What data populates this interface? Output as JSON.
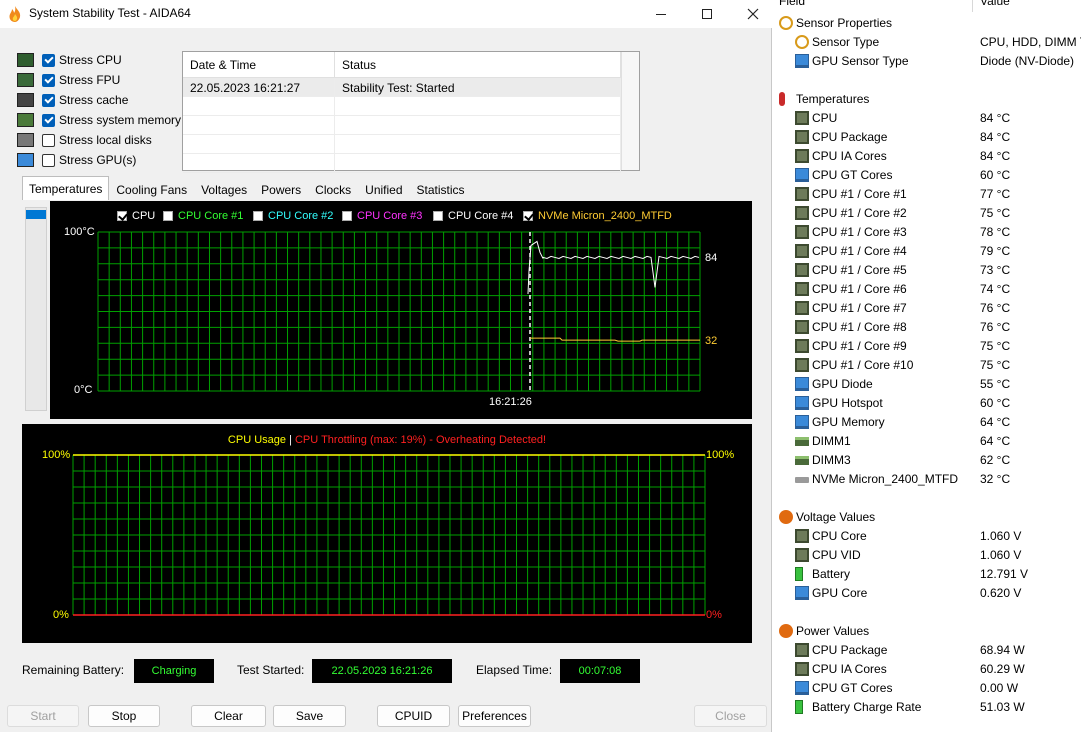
{
  "window": {
    "title": "System Stability Test - AIDA64",
    "buttons": {
      "minimize": "—",
      "maximize": "□",
      "close": "✕"
    }
  },
  "stress_options": [
    {
      "label": "Stress CPU",
      "checked": true,
      "icon": "cpu-icon"
    },
    {
      "label": "Stress FPU",
      "checked": true,
      "icon": "fpu-icon"
    },
    {
      "label": "Stress cache",
      "checked": true,
      "icon": "cache-icon"
    },
    {
      "label": "Stress system memory",
      "checked": true,
      "icon": "memory-icon"
    },
    {
      "label": "Stress local disks",
      "checked": false,
      "icon": "disk-icon"
    },
    {
      "label": "Stress GPU(s)",
      "checked": false,
      "icon": "gpu-icon"
    }
  ],
  "log": {
    "headers": [
      "Date & Time",
      "Status"
    ],
    "rows": [
      {
        "datetime": "22.05.2023 16:21:27",
        "status": "Stability Test: Started"
      }
    ]
  },
  "tabs": [
    "Temperatures",
    "Cooling Fans",
    "Voltages",
    "Powers",
    "Clocks",
    "Unified",
    "Statistics"
  ],
  "temp_graph": {
    "legend": [
      {
        "label": "CPU",
        "checked": true,
        "color": "#ffffff"
      },
      {
        "label": "CPU Core #1",
        "checked": false,
        "color": "#33ff33"
      },
      {
        "label": "CPU Core #2",
        "checked": false,
        "color": "#33ffff"
      },
      {
        "label": "CPU Core #3",
        "checked": false,
        "color": "#ff33ff"
      },
      {
        "label": "CPU Core #4",
        "checked": false,
        "color": "#ffffff"
      },
      {
        "label": "NVMe Micron_2400_MTFD",
        "checked": true,
        "color": "#ffcc33"
      }
    ],
    "y_max_label": "100°C",
    "y_min_label": "0°C",
    "time_label": "16:21:26",
    "cpu_value_label": "84",
    "nvme_value_label": "32",
    "cpu_value": 84,
    "nvme_value": 32,
    "grid_color": "#00a000"
  },
  "usage_graph": {
    "title_usage": "CPU Usage",
    "title_sep": "|",
    "title_throttle": "CPU Throttling (max: 19%) - Overheating Detected!",
    "left_max": "100%",
    "left_min": "0%",
    "right_max": "100%",
    "right_min": "0%",
    "usage_color": "#ffff00",
    "throttle_color": "#ff2020"
  },
  "status_bar": {
    "battery_label": "Remaining Battery:",
    "battery_value": "Charging",
    "started_label": "Test Started:",
    "started_value": "22.05.2023 16:21:26",
    "elapsed_label": "Elapsed Time:",
    "elapsed_value": "00:07:08"
  },
  "buttons": {
    "start": "Start",
    "stop": "Stop",
    "clear": "Clear",
    "save": "Save",
    "cpuid": "CPUID",
    "preferences": "Preferences",
    "close": "Close"
  },
  "sensor_panel": {
    "col_field": "Field",
    "col_value": "Value",
    "groups": [
      {
        "title": "Sensor Properties",
        "icon": "sensor-icon",
        "items": [
          {
            "name": "Sensor Type",
            "value": "CPU, HDD, DIMM T",
            "icon": "gauge-icon"
          },
          {
            "name": "GPU Sensor Type",
            "value": "Diode  (NV-Diode)",
            "icon": "monitor-icon"
          }
        ]
      },
      {
        "title": "Temperatures",
        "icon": "thermometer-icon",
        "items": [
          {
            "name": "CPU",
            "value": "84 °C",
            "icon": "chip-icon"
          },
          {
            "name": "CPU Package",
            "value": "84 °C",
            "icon": "chip-icon"
          },
          {
            "name": "CPU IA Cores",
            "value": "84 °C",
            "icon": "chip-icon"
          },
          {
            "name": "CPU GT Cores",
            "value": "60 °C",
            "icon": "monitor-icon"
          },
          {
            "name": "CPU #1 / Core #1",
            "value": "77 °C",
            "icon": "chip-icon"
          },
          {
            "name": "CPU #1 / Core #2",
            "value": "75 °C",
            "icon": "chip-icon"
          },
          {
            "name": "CPU #1 / Core #3",
            "value": "78 °C",
            "icon": "chip-icon"
          },
          {
            "name": "CPU #1 / Core #4",
            "value": "79 °C",
            "icon": "chip-icon"
          },
          {
            "name": "CPU #1 / Core #5",
            "value": "73 °C",
            "icon": "chip-icon"
          },
          {
            "name": "CPU #1 / Core #6",
            "value": "74 °C",
            "icon": "chip-icon"
          },
          {
            "name": "CPU #1 / Core #7",
            "value": "76 °C",
            "icon": "chip-icon"
          },
          {
            "name": "CPU #1 / Core #8",
            "value": "76 °C",
            "icon": "chip-icon"
          },
          {
            "name": "CPU #1 / Core #9",
            "value": "75 °C",
            "icon": "chip-icon"
          },
          {
            "name": "CPU #1 / Core #10",
            "value": "75 °C",
            "icon": "chip-icon"
          },
          {
            "name": "GPU Diode",
            "value": "55 °C",
            "icon": "monitor-icon"
          },
          {
            "name": "GPU Hotspot",
            "value": "60 °C",
            "icon": "monitor-icon"
          },
          {
            "name": "GPU Memory",
            "value": "64 °C",
            "icon": "monitor-icon"
          },
          {
            "name": "DIMM1",
            "value": "64 °C",
            "icon": "dimm-icon"
          },
          {
            "name": "DIMM3",
            "value": "62 °C",
            "icon": "dimm-icon"
          },
          {
            "name": "NVMe Micron_2400_MTFD",
            "value": "32 °C",
            "icon": "nvme-icon"
          }
        ]
      },
      {
        "title": "Voltage Values",
        "icon": "voltage-icon",
        "items": [
          {
            "name": "CPU Core",
            "value": "1.060 V",
            "icon": "chip-icon"
          },
          {
            "name": "CPU VID",
            "value": "1.060 V",
            "icon": "chip-icon"
          },
          {
            "name": "Battery",
            "value": "12.791 V",
            "icon": "battery-icon"
          },
          {
            "name": "GPU Core",
            "value": "0.620 V",
            "icon": "monitor-icon"
          }
        ]
      },
      {
        "title": "Power Values",
        "icon": "power-icon",
        "items": [
          {
            "name": "CPU Package",
            "value": "68.94 W",
            "icon": "chip-icon"
          },
          {
            "name": "CPU IA Cores",
            "value": "60.29 W",
            "icon": "chip-icon"
          },
          {
            "name": "CPU GT Cores",
            "value": "0.00 W",
            "icon": "monitor-icon"
          },
          {
            "name": "Battery Charge Rate",
            "value": "51.03 W",
            "icon": "battery-icon"
          }
        ]
      }
    ]
  }
}
